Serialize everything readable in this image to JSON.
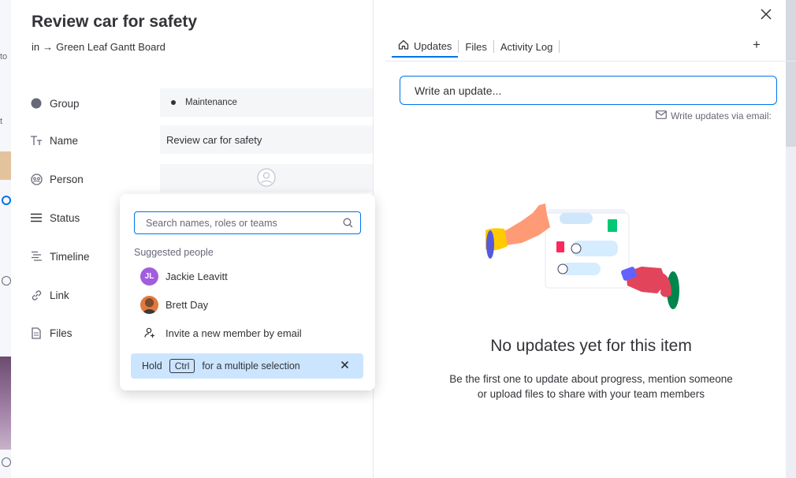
{
  "item": {
    "title": "Review car for safety",
    "breadcrumb_prefix": "in",
    "breadcrumb_arrow": "→",
    "board": "Green Leaf Gantt Board"
  },
  "fields": {
    "group": {
      "label": "Group",
      "value": "Maintenance"
    },
    "name": {
      "label": "Name",
      "value": "Review car for safety"
    },
    "person": {
      "label": "Person"
    },
    "status": {
      "label": "Status"
    },
    "timeline": {
      "label": "Timeline"
    },
    "link": {
      "label": "Link"
    },
    "files": {
      "label": "Files"
    }
  },
  "person_picker": {
    "search_placeholder": "Search names, roles or teams",
    "suggested_heading": "Suggested people",
    "people": [
      {
        "initials": "JL",
        "name": "Jackie Leavitt",
        "color": "#a25ddc"
      },
      {
        "name": "Brett Day"
      }
    ],
    "invite_label": "Invite a new member by email",
    "hint_prefix": "Hold",
    "hint_key": "Ctrl",
    "hint_suffix": "for a multiple selection"
  },
  "tabs": [
    {
      "label": "Updates",
      "icon": "home-icon",
      "active": true
    },
    {
      "label": "Files"
    },
    {
      "label": "Activity Log"
    }
  ],
  "tab_add": "+",
  "updates": {
    "input_placeholder": "Write an update...",
    "email_link": "Write updates via email:",
    "empty_title": "No updates yet for this item",
    "empty_line1": "Be the first one to update about progress, mention someone",
    "empty_line2": "or upload files to share with your team members"
  },
  "colors": {
    "accent": "#0073ea",
    "hint_bg": "#cce5ff",
    "field_bg": "#f5f6f8"
  }
}
